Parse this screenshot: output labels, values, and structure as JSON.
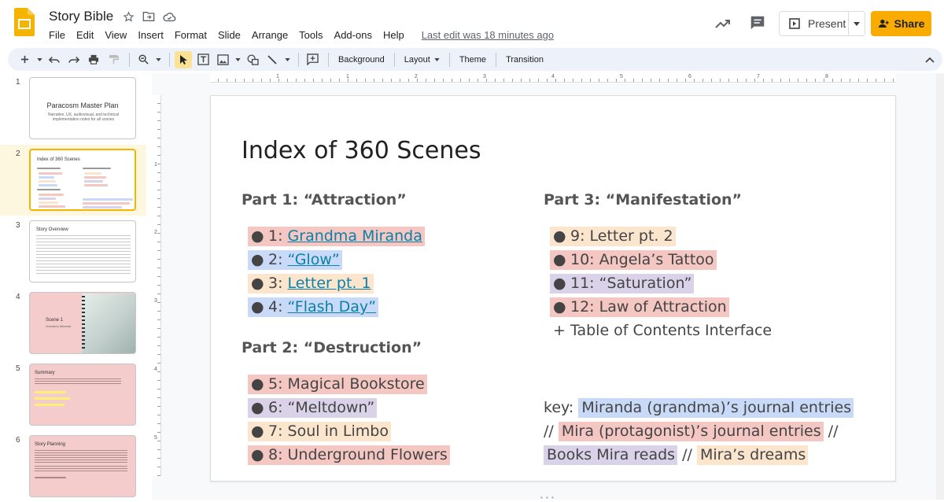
{
  "app": {
    "doc_title": "Story Bible",
    "menu": [
      "File",
      "Edit",
      "View",
      "Insert",
      "Format",
      "Slide",
      "Arrange",
      "Tools",
      "Add-ons",
      "Help"
    ],
    "last_edit": "Last edit was 18 minutes ago",
    "present_label": "Present",
    "share_label": "Share",
    "accent": "#f9ab00"
  },
  "toolbar": {
    "background_label": "Background",
    "layout_label": "Layout",
    "theme_label": "Theme",
    "transition_label": "Transition"
  },
  "ruler": {
    "h_labels": [
      "1",
      "1",
      "2",
      "3",
      "4",
      "5",
      "6",
      "7",
      "8",
      "9"
    ],
    "v_labels": [
      "1",
      "2",
      "3",
      "4",
      "5"
    ]
  },
  "filmstrip": {
    "numbers": [
      "1",
      "2",
      "3",
      "4",
      "5",
      "6"
    ],
    "slide1_title": "Paracosm Master Plan",
    "slide1_sub": "Narrative, UX, audiovisual, and technical implementation notes for all scenes",
    "slide2_title": "Index of 360 Scenes",
    "slide3_title": "Story Overview",
    "slide4_title": "Scene 1",
    "slide4_sub": "Grandma Miranda",
    "slide5_title": "Summary",
    "slide6_title": "Story Planning"
  },
  "slide": {
    "title": "Index of 360 Scenes",
    "part1": {
      "heading": "Part 1: “Attraction”",
      "items": [
        {
          "num": "1: ",
          "text": "Grandma Miranda"
        },
        {
          "num": "2: ",
          "text": "“Glow”"
        },
        {
          "num": "3: ",
          "text": "Letter pt. 1"
        },
        {
          "num": "4: ",
          "text": "“Flash Day”"
        }
      ]
    },
    "part2": {
      "heading": "Part 2: “Destruction”",
      "items": [
        "5: Magical Bookstore",
        "6: “Meltdown”",
        "7: Soul in Limbo",
        "8: Underground Flowers"
      ]
    },
    "part3": {
      "heading": "Part 3: “Manifestation”",
      "items": [
        "9: Letter pt. 2",
        "10: Angela’s Tattoo",
        "11: “Saturation”",
        "12: Law of Attraction"
      ],
      "extra_symbol": "+",
      "extra": "Table of Contents Interface"
    },
    "key": {
      "prefix": "key: ",
      "miranda": "Miranda (grandma)’s journal entries",
      "sep1": "// ",
      "mira": "Mira (protagonist)’s journal entries",
      "sep2": " //",
      "books": "Books Mira reads",
      "sep3": " // ",
      "dreams": "Mira’s dreams"
    },
    "bullet": "●",
    "colors": {
      "miranda": "#c9daf8",
      "mira": "#f4c7c3",
      "books": "#d9d2e9",
      "dreams": "#fce5cd"
    }
  }
}
